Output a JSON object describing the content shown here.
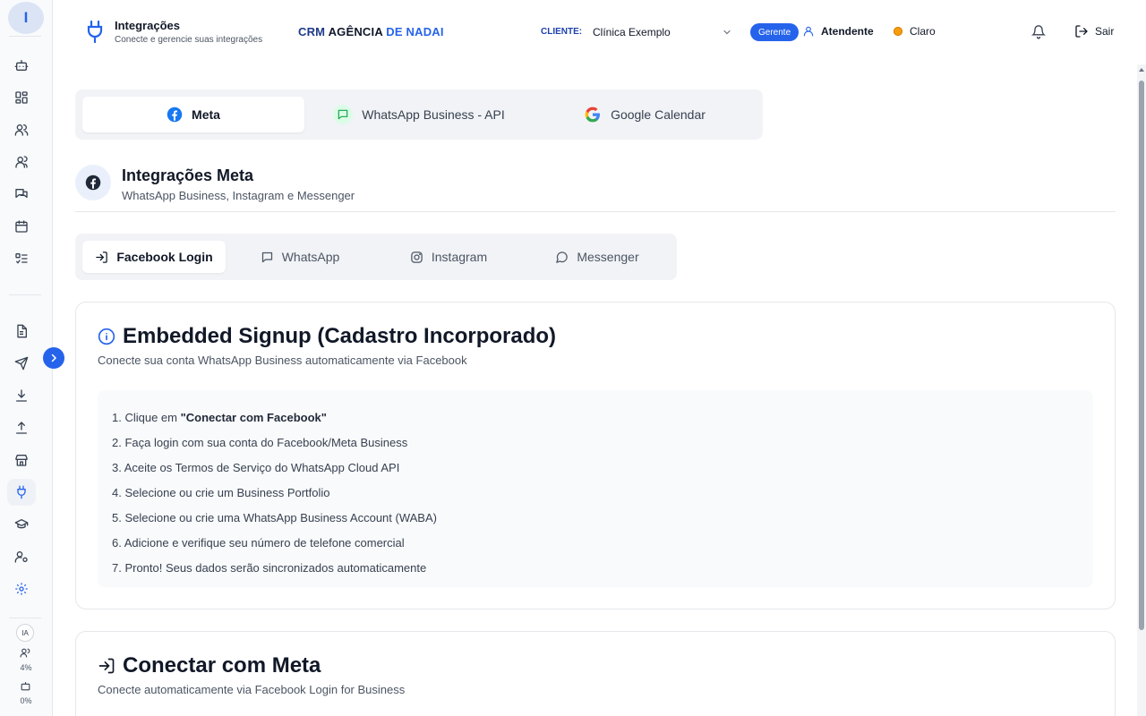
{
  "sidebar": {
    "avatar_initial": "I",
    "icons": [
      {
        "name": "bot-icon"
      },
      {
        "name": "dashboard-icon"
      },
      {
        "name": "users-icon"
      },
      {
        "name": "contacts-icon"
      },
      {
        "name": "chat-icon"
      },
      {
        "name": "calendar-icon"
      },
      {
        "name": "list-check-icon"
      },
      {
        "name": "document-icon"
      },
      {
        "name": "send-icon"
      },
      {
        "name": "download-icon"
      },
      {
        "name": "upload-icon"
      },
      {
        "name": "store-icon"
      },
      {
        "name": "plug-icon",
        "active": true
      },
      {
        "name": "graduation-cap-icon"
      },
      {
        "name": "user-settings-icon"
      },
      {
        "name": "gear-icon"
      }
    ],
    "ia_label": "IA",
    "usage_users": "4%",
    "usage_bot": "0%"
  },
  "header": {
    "title": "Integrações",
    "subtitle": "Conecte e gerencie suas integrações",
    "brand_part1": "CRM",
    "brand_part2": "AGÊNCIA",
    "brand_part3": "DE NADAI",
    "client_label": "CLIENTE:",
    "client_value": "Clínica Exemplo",
    "role_badge": "Gerente",
    "user_label": "Atendente",
    "theme_label": "Claro",
    "logout_label": "Sair"
  },
  "main_tabs": [
    {
      "label": "Meta",
      "active": true
    },
    {
      "label": "WhatsApp Business - API",
      "active": false
    },
    {
      "label": "Google Calendar",
      "active": false
    }
  ],
  "section": {
    "title": "Integrações Meta",
    "subtitle": "WhatsApp Business, Instagram e Messenger"
  },
  "sub_tabs": [
    {
      "label": "Facebook Login",
      "active": true
    },
    {
      "label": "WhatsApp",
      "active": false
    },
    {
      "label": "Instagram",
      "active": false
    },
    {
      "label": "Messenger",
      "active": false
    }
  ],
  "embedded_card": {
    "title": "Embedded Signup (Cadastro Incorporado)",
    "subtitle": "Conecte sua conta WhatsApp Business automaticamente via Facebook",
    "step1_prefix": "1. Clique em ",
    "step1_bold": "\"Conectar com Facebook\"",
    "steps": [
      "2. Faça login com sua conta do Facebook/Meta Business",
      "3. Aceite os Termos de Serviço do WhatsApp Cloud API",
      "4. Selecione ou crie um Business Portfolio",
      "5. Selecione ou crie uma WhatsApp Business Account (WABA)",
      "6. Adicione e verifique seu número de telefone comercial",
      "7. Pronto! Seus dados serão sincronizados automaticamente"
    ]
  },
  "connect_card": {
    "title": "Conectar com Meta",
    "subtitle": "Conecte automaticamente via Facebook Login for Business"
  },
  "colors": {
    "accent": "#2563eb",
    "facebook": "#1877f2",
    "whatsapp": "#25d366"
  }
}
